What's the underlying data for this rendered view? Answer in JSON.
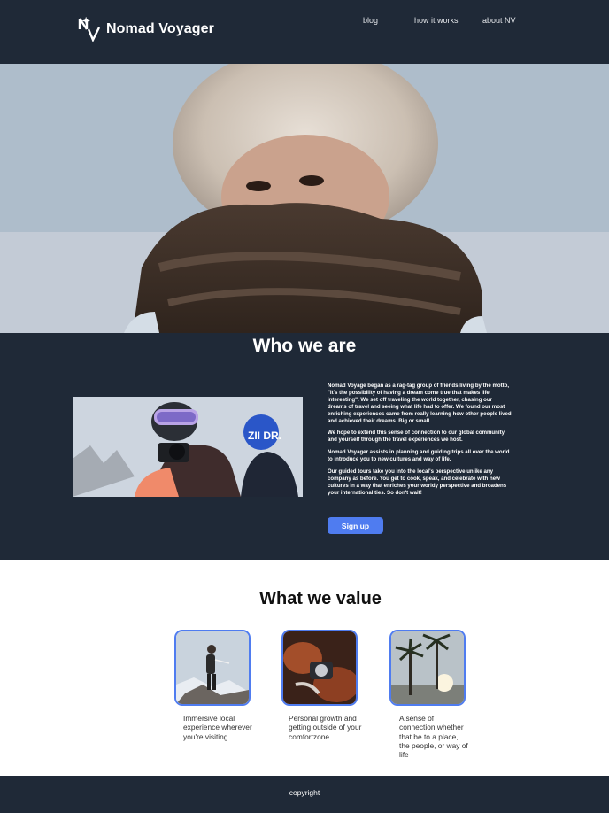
{
  "header": {
    "logo_text": "Nomad Voyager",
    "logo_mark": "NV",
    "nav": [
      {
        "label": "blog"
      },
      {
        "label": "how it works"
      },
      {
        "label": "about NV"
      }
    ]
  },
  "hero": {
    "image": "person-in-fur-hat-photo"
  },
  "who": {
    "title": "Who we are",
    "image": "skier-with-camera-photo",
    "paragraphs": [
      "Nomad Voyage began as a rag-tag group of friends living by the motto, \"It's the possibility of having a dream come true that makes life interesting\". We set off traveling the world together, chasing our dreams of travel and seeing what life had to offer. We found our most enriching experiences came from really learning how other people lived and achieved their dreams. Big or small.",
      "We hope to extend this sense of connection to our global community and yourself through the travel experiences we host.",
      "Nomad Voyager assists in planning and guiding trips all over the world to introduce you to new cultures and way of life.",
      "Our guided tours take you into the local's perspective unlike any company as before. You get to cook, speak, and celebrate with new cultures in a way that enriches your worldy perspective and broadens your international ties.  So don't wait!"
    ],
    "signup_label": "Sign up"
  },
  "values": {
    "title": "What we value",
    "items": [
      {
        "text": "Immersive local experience wherever you're visiting",
        "image": "hiker-on-mountain-photo"
      },
      {
        "text": "Personal growth and getting outside of your comfortzone",
        "image": "hands-with-compass-photo"
      },
      {
        "text": "A sense of connection whether that be to a place, the people, or way of life",
        "image": "palm-trees-sunset-photo"
      }
    ]
  },
  "footer": {
    "text": "copyright"
  },
  "colors": {
    "header_bg": "#1f2937",
    "accent": "#4f7cf0",
    "page_bg": "#ffffff"
  }
}
